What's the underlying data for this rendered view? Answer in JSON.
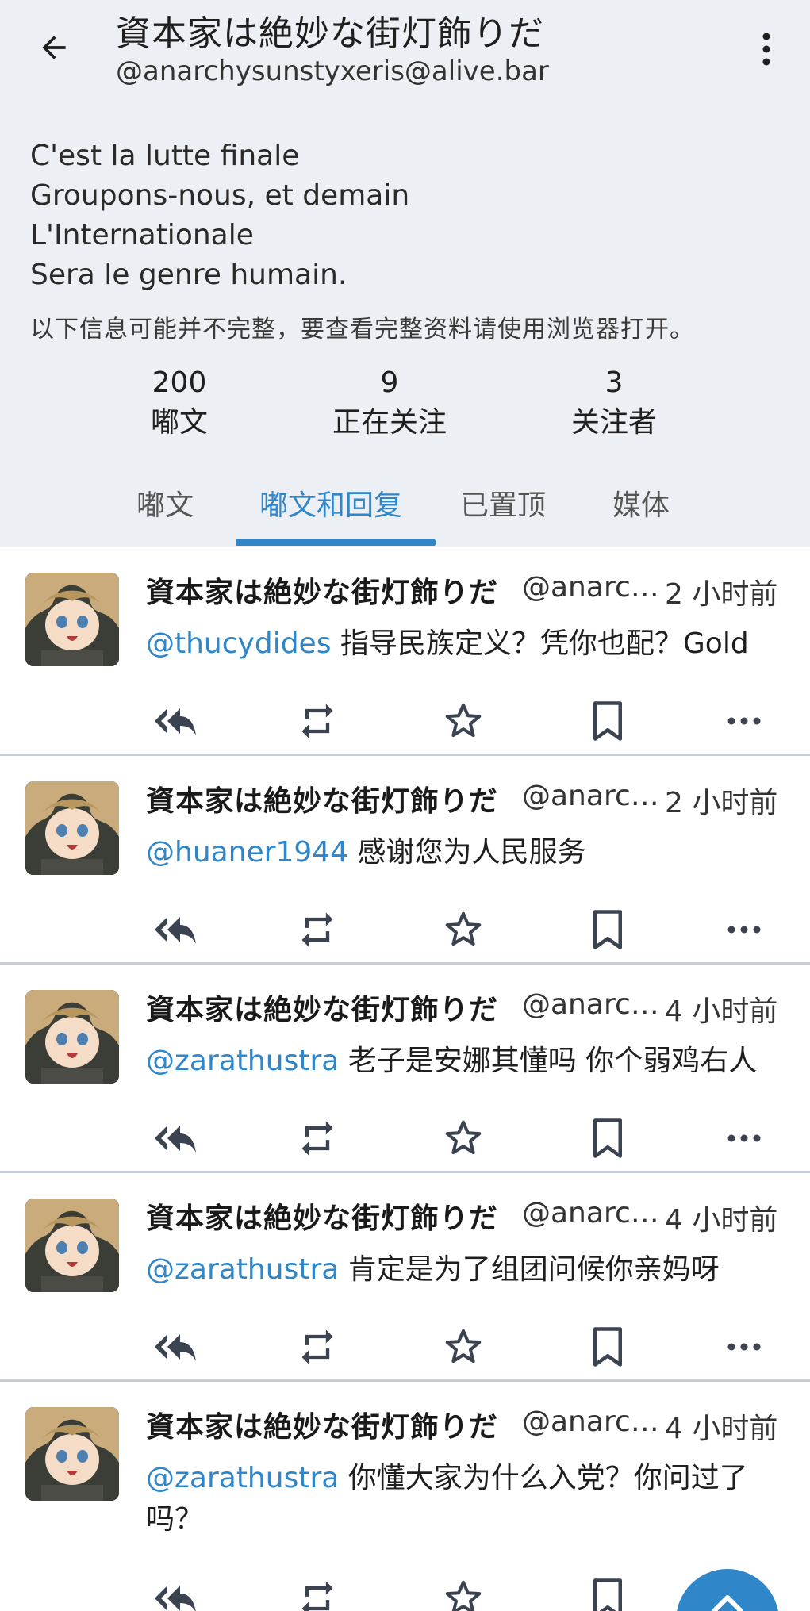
{
  "header": {
    "title": "資本家は絶妙な街灯飾りだ",
    "handle": "@anarchysunstyxeris@alive.bar",
    "bio": [
      "C'est la lutte finale",
      "Groupons-nous, et demain",
      "L'Internationale",
      "Sera le genre humain."
    ],
    "notice": "以下信息可能并不完整，要查看完整资料请使用浏览器打开。",
    "stats": [
      {
        "value": "200",
        "label": "嘟文"
      },
      {
        "value": "9",
        "label": "正在关注"
      },
      {
        "value": "3",
        "label": "关注者"
      }
    ]
  },
  "tabs": [
    {
      "label": "嘟文",
      "active": false
    },
    {
      "label": "嘟文和回复",
      "active": true
    },
    {
      "label": "已置顶",
      "active": false
    },
    {
      "label": "媒体",
      "active": false
    }
  ],
  "posts": [
    {
      "name": "資本家は絶妙な街灯飾りだ",
      "handle": "@anarc…",
      "time": "2 小时前",
      "mention": "@thucydides",
      "text": " 指导民族定义？凭你也配？Gold"
    },
    {
      "name": "資本家は絶妙な街灯飾りだ",
      "handle": "@anarc…",
      "time": "2 小时前",
      "mention": "@huaner1944",
      "text": " 感谢您为人民服务"
    },
    {
      "name": "資本家は絶妙な街灯飾りだ",
      "handle": "@anarc…",
      "time": "4 小时前",
      "mention": "@zarathustra",
      "text": " 老子是安娜其懂吗 你个弱鸡右人"
    },
    {
      "name": "資本家は絶妙な街灯飾りだ",
      "handle": "@anarc…",
      "time": "4 小时前",
      "mention": "@zarathustra",
      "text": " 肯定是为了组团问候你亲妈呀"
    },
    {
      "name": "資本家は絶妙な街灯飾りだ",
      "handle": "@anarc…",
      "time": "4 小时前",
      "mention": "@zarathustra",
      "text": " 你懂大家为什么入党？你问过了吗？"
    }
  ],
  "icons": {
    "back": "arrow-left-icon",
    "menu": "more-vertical-icon",
    "reply": "reply-all-icon",
    "boost": "repeat-icon",
    "favourite": "star-icon",
    "bookmark": "bookmark-icon",
    "more": "more-horizontal-icon",
    "fab": "chevron-up-icon"
  },
  "colors": {
    "accent": "#2f86c9",
    "header_bg": "#eceff3",
    "divider": "#c7cdd6"
  }
}
